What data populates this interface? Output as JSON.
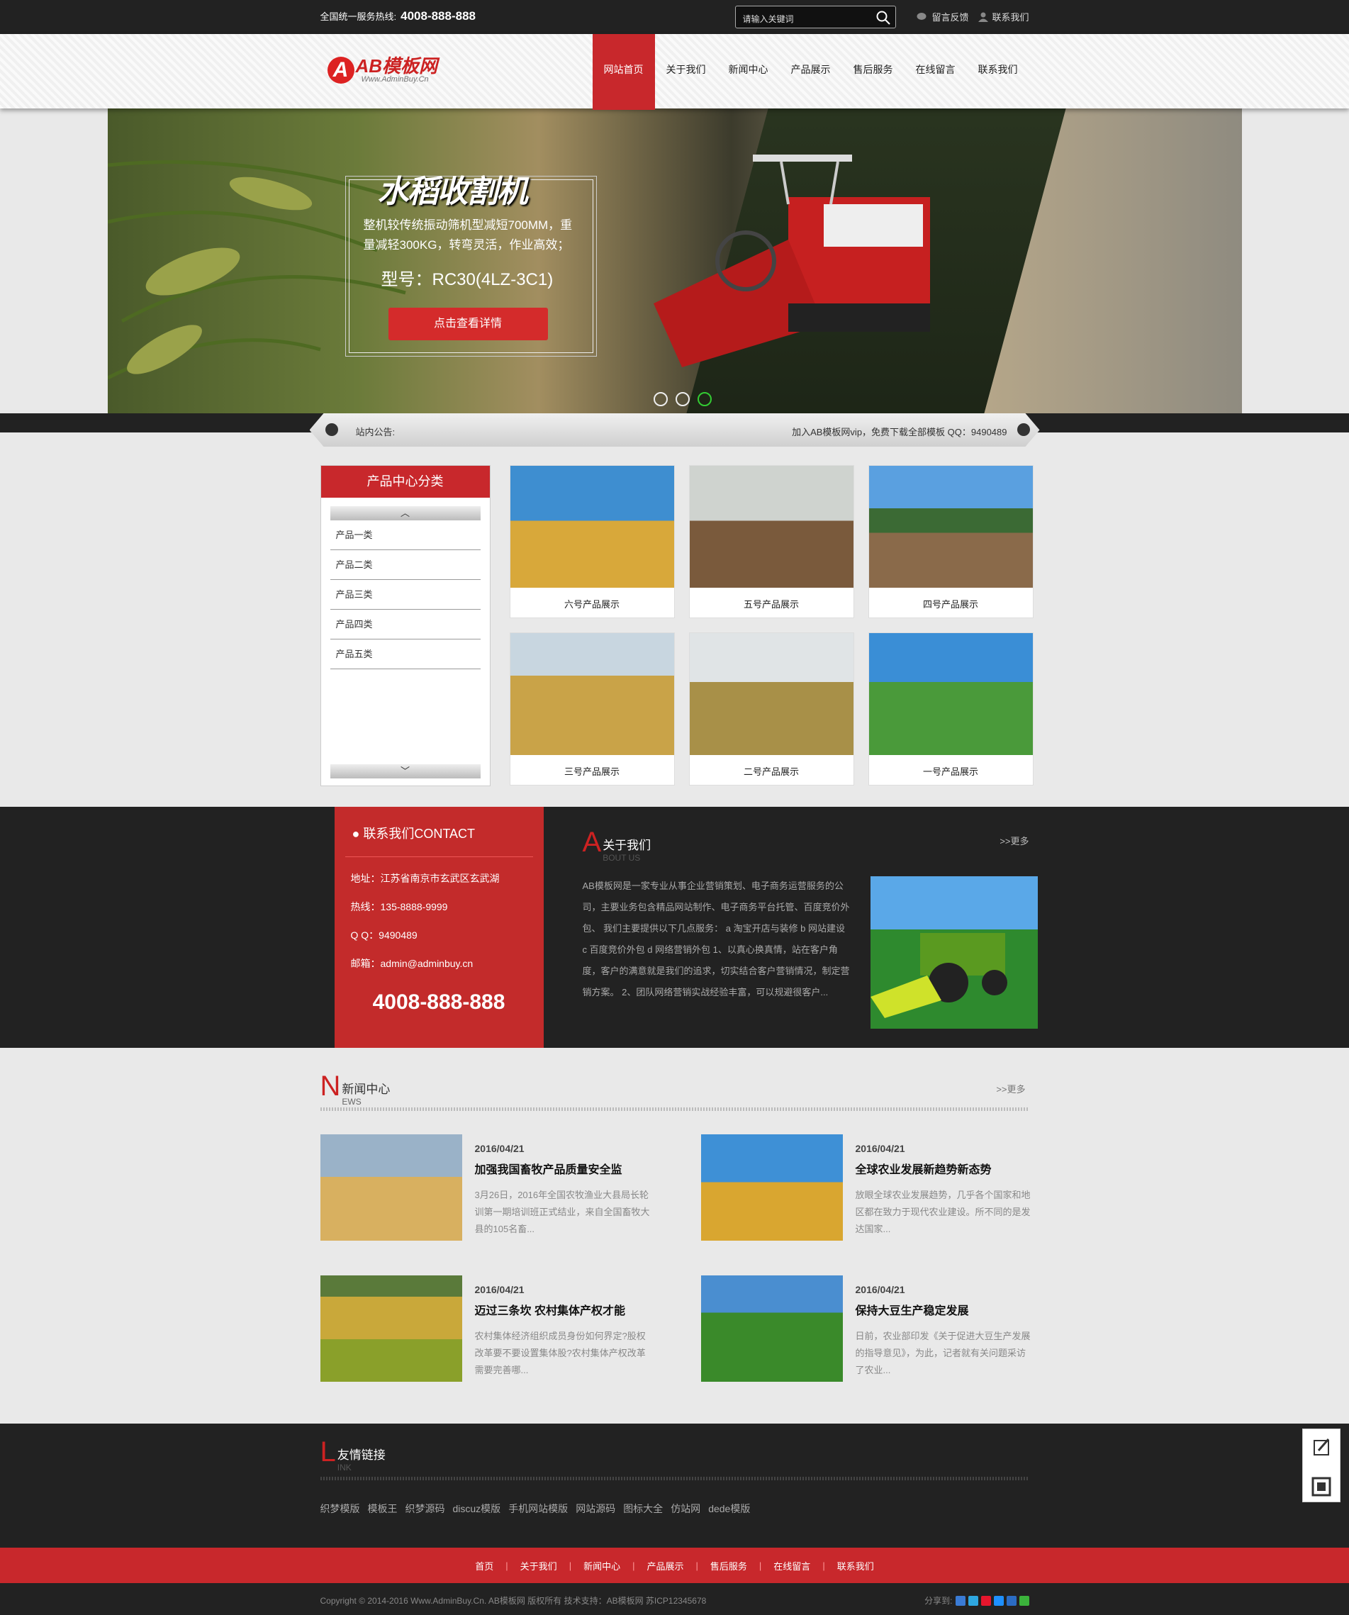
{
  "topbar": {
    "hotline_label": "全国统一服务热线:",
    "hotline_number": "4008-888-888",
    "search_placeholder": "请输入关键词",
    "links": [
      "留言反馈",
      "联系我们"
    ]
  },
  "logo": {
    "mark": "A",
    "name": "AB模板网",
    "url": "Www.AdminBuy.Cn"
  },
  "nav": [
    "网站首页",
    "关于我们",
    "新闻中心",
    "产品展示",
    "售后服务",
    "在线留言",
    "联系我们"
  ],
  "banner": {
    "title": "水稻收割机",
    "desc": "整机较传统振动筛机型减短700MM，重量减轻300KG，转弯灵活，作业高效；",
    "model": "型号：RC30(4LZ-3C1)",
    "button": "点击查看详情"
  },
  "notice": {
    "label": "站内公告:",
    "text": "加入AB模板网vip，免费下载全部模板 QQ：9490489"
  },
  "sidebar": {
    "title": "产品中心分类",
    "up": "︿",
    "down": "﹀",
    "items": [
      "产品一类",
      "产品二类",
      "产品三类",
      "产品四类",
      "产品五类"
    ]
  },
  "products": [
    "六号产品展示",
    "五号产品展示",
    "四号产品展示",
    "三号产品展示",
    "二号产品展示",
    "一号产品展示"
  ],
  "contact": {
    "title": "联系我们CONTACT",
    "address": "地址：江苏省南京市玄武区玄武湖",
    "phone": "热线：135-8888-9999",
    "qq": "Q Q：9490489",
    "email": "邮箱：admin@adminbuy.cn",
    "bigphone": "4008-888-888"
  },
  "about": {
    "big": "A",
    "title": "关于我们",
    "en": "BOUT US",
    "more": ">>更多",
    "text": "AB模板网是一家专业从事企业营销策划、电子商务运营服务的公司，主要业务包含精品网站制作、电子商务平台托管、百度竞价外包、 我们主要提供以下几点服务： a 淘宝开店与装修 b 网站建设 c 百度竞价外包 d 网络营销外包 1、以真心换真情，站在客户角度，客户的满意就是我们的追求，切实结合客户营销情况，制定营销方案。 2、团队网络营销实战经验丰富，可以规避很客户..."
  },
  "news": {
    "big": "N",
    "title": "新闻中心",
    "en": "EWS",
    "more": ">>更多",
    "items": [
      {
        "date": "2016/04/21",
        "title": "加强我国畜牧产品质量安全监",
        "summary": "3月26日，2016年全国农牧渔业大县局长轮训第一期培训班正式结业，来自全国畜牧大县的105名畜..."
      },
      {
        "date": "2016/04/21",
        "title": "全球农业发展新趋势新态势",
        "summary": "放眼全球农业发展趋势，几乎各个国家和地区都在致力于现代农业建设。所不同的是发达国家..."
      },
      {
        "date": "2016/04/21",
        "title": "迈过三条坎 农村集体产权才能",
        "summary": "农村集体经济组织成员身份如何界定?股权改革要不要设置集体股?农村集体产权改革需要完善哪..."
      },
      {
        "date": "2016/04/21",
        "title": "保持大豆生产稳定发展",
        "summary": "日前，农业部印发《关于促进大豆生产发展的指导意见》，为此，记者就有关问题采访了农业..."
      }
    ]
  },
  "links": {
    "big": "L",
    "title": "友情链接",
    "en": "INK",
    "items": [
      "织梦模版",
      "模板王",
      "织梦源码",
      "discuz模版",
      "手机网站模版",
      "网站源码",
      "图标大全",
      "仿站网",
      "dede模版"
    ]
  },
  "footnav": [
    "首页",
    "关于我们",
    "新闻中心",
    "产品展示",
    "售后服务",
    "在线留言",
    "联系我们"
  ],
  "copyright": "Copyright © 2014-2016 Www.AdminBuy.Cn. AB模板网 版权所有    技术支持：AB模板网    苏ICP12345678",
  "share_label": "分享到:"
}
